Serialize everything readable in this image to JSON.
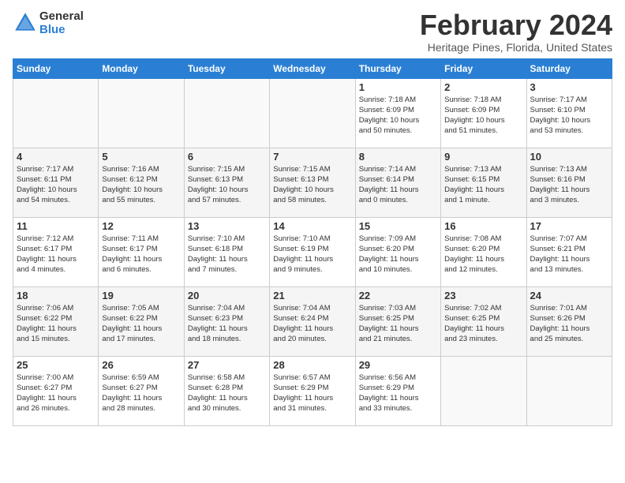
{
  "header": {
    "logo_general": "General",
    "logo_blue": "Blue",
    "month_year": "February 2024",
    "location": "Heritage Pines, Florida, United States"
  },
  "days_of_week": [
    "Sunday",
    "Monday",
    "Tuesday",
    "Wednesday",
    "Thursday",
    "Friday",
    "Saturday"
  ],
  "weeks": [
    [
      {
        "day": "",
        "info": ""
      },
      {
        "day": "",
        "info": ""
      },
      {
        "day": "",
        "info": ""
      },
      {
        "day": "",
        "info": ""
      },
      {
        "day": "1",
        "info": "Sunrise: 7:18 AM\nSunset: 6:09 PM\nDaylight: 10 hours\nand 50 minutes."
      },
      {
        "day": "2",
        "info": "Sunrise: 7:18 AM\nSunset: 6:09 PM\nDaylight: 10 hours\nand 51 minutes."
      },
      {
        "day": "3",
        "info": "Sunrise: 7:17 AM\nSunset: 6:10 PM\nDaylight: 10 hours\nand 53 minutes."
      }
    ],
    [
      {
        "day": "4",
        "info": "Sunrise: 7:17 AM\nSunset: 6:11 PM\nDaylight: 10 hours\nand 54 minutes."
      },
      {
        "day": "5",
        "info": "Sunrise: 7:16 AM\nSunset: 6:12 PM\nDaylight: 10 hours\nand 55 minutes."
      },
      {
        "day": "6",
        "info": "Sunrise: 7:15 AM\nSunset: 6:13 PM\nDaylight: 10 hours\nand 57 minutes."
      },
      {
        "day": "7",
        "info": "Sunrise: 7:15 AM\nSunset: 6:13 PM\nDaylight: 10 hours\nand 58 minutes."
      },
      {
        "day": "8",
        "info": "Sunrise: 7:14 AM\nSunset: 6:14 PM\nDaylight: 11 hours\nand 0 minutes."
      },
      {
        "day": "9",
        "info": "Sunrise: 7:13 AM\nSunset: 6:15 PM\nDaylight: 11 hours\nand 1 minute."
      },
      {
        "day": "10",
        "info": "Sunrise: 7:13 AM\nSunset: 6:16 PM\nDaylight: 11 hours\nand 3 minutes."
      }
    ],
    [
      {
        "day": "11",
        "info": "Sunrise: 7:12 AM\nSunset: 6:17 PM\nDaylight: 11 hours\nand 4 minutes."
      },
      {
        "day": "12",
        "info": "Sunrise: 7:11 AM\nSunset: 6:17 PM\nDaylight: 11 hours\nand 6 minutes."
      },
      {
        "day": "13",
        "info": "Sunrise: 7:10 AM\nSunset: 6:18 PM\nDaylight: 11 hours\nand 7 minutes."
      },
      {
        "day": "14",
        "info": "Sunrise: 7:10 AM\nSunset: 6:19 PM\nDaylight: 11 hours\nand 9 minutes."
      },
      {
        "day": "15",
        "info": "Sunrise: 7:09 AM\nSunset: 6:20 PM\nDaylight: 11 hours\nand 10 minutes."
      },
      {
        "day": "16",
        "info": "Sunrise: 7:08 AM\nSunset: 6:20 PM\nDaylight: 11 hours\nand 12 minutes."
      },
      {
        "day": "17",
        "info": "Sunrise: 7:07 AM\nSunset: 6:21 PM\nDaylight: 11 hours\nand 13 minutes."
      }
    ],
    [
      {
        "day": "18",
        "info": "Sunrise: 7:06 AM\nSunset: 6:22 PM\nDaylight: 11 hours\nand 15 minutes."
      },
      {
        "day": "19",
        "info": "Sunrise: 7:05 AM\nSunset: 6:22 PM\nDaylight: 11 hours\nand 17 minutes."
      },
      {
        "day": "20",
        "info": "Sunrise: 7:04 AM\nSunset: 6:23 PM\nDaylight: 11 hours\nand 18 minutes."
      },
      {
        "day": "21",
        "info": "Sunrise: 7:04 AM\nSunset: 6:24 PM\nDaylight: 11 hours\nand 20 minutes."
      },
      {
        "day": "22",
        "info": "Sunrise: 7:03 AM\nSunset: 6:25 PM\nDaylight: 11 hours\nand 21 minutes."
      },
      {
        "day": "23",
        "info": "Sunrise: 7:02 AM\nSunset: 6:25 PM\nDaylight: 11 hours\nand 23 minutes."
      },
      {
        "day": "24",
        "info": "Sunrise: 7:01 AM\nSunset: 6:26 PM\nDaylight: 11 hours\nand 25 minutes."
      }
    ],
    [
      {
        "day": "25",
        "info": "Sunrise: 7:00 AM\nSunset: 6:27 PM\nDaylight: 11 hours\nand 26 minutes."
      },
      {
        "day": "26",
        "info": "Sunrise: 6:59 AM\nSunset: 6:27 PM\nDaylight: 11 hours\nand 28 minutes."
      },
      {
        "day": "27",
        "info": "Sunrise: 6:58 AM\nSunset: 6:28 PM\nDaylight: 11 hours\nand 30 minutes."
      },
      {
        "day": "28",
        "info": "Sunrise: 6:57 AM\nSunset: 6:29 PM\nDaylight: 11 hours\nand 31 minutes."
      },
      {
        "day": "29",
        "info": "Sunrise: 6:56 AM\nSunset: 6:29 PM\nDaylight: 11 hours\nand 33 minutes."
      },
      {
        "day": "",
        "info": ""
      },
      {
        "day": "",
        "info": ""
      }
    ]
  ]
}
